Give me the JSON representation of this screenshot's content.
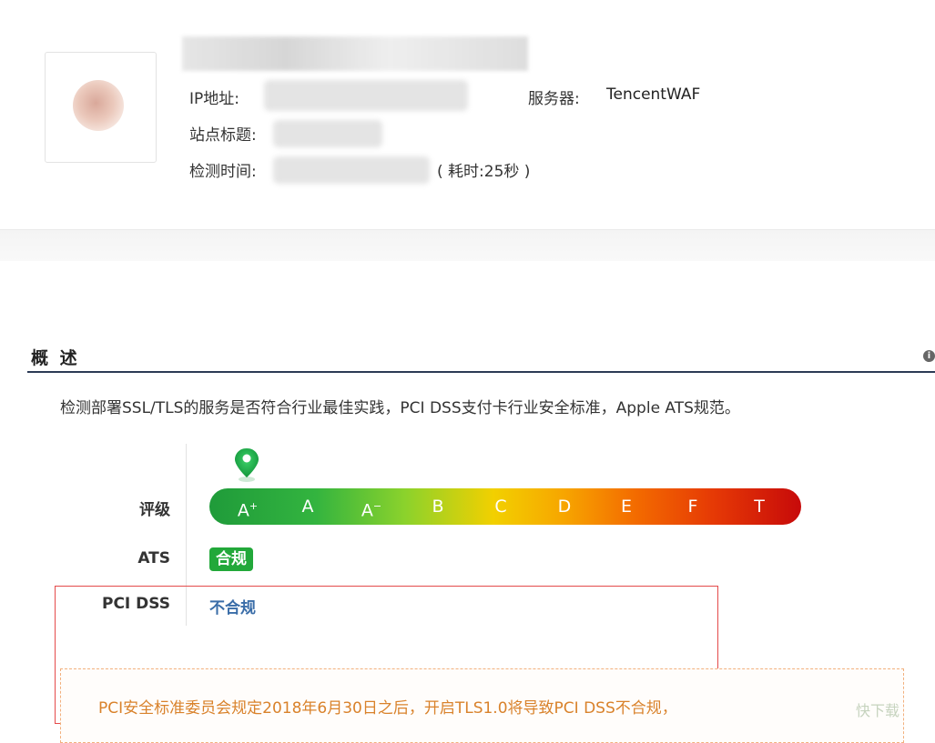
{
  "site": {
    "ip_label": "IP地址:",
    "server_label": "服务器:",
    "server_value": "TencentWAF",
    "title_label": "站点标题:",
    "time_label": "检测时间:",
    "duration_text": "( 耗时:25秒 )"
  },
  "overview": {
    "title": "概 述",
    "info_icon": "info-icon",
    "description": "检测部署SSL/TLS的服务是否符合行业最佳实践，PCI DSS支付卡行业安全标准，Apple ATS规范。"
  },
  "rating": {
    "label": "评级",
    "grades": [
      "A",
      "A",
      "A",
      "B",
      "C",
      "D",
      "E",
      "F",
      "T"
    ],
    "grade_a_plus_suffix": "+",
    "grade_a_minus_suffix": "−",
    "current_index": 0,
    "pin_icon": "map-pin-icon",
    "colors": {
      "start": "#1f9b3a",
      "mid": "#f2d000",
      "end": "#c70a0a"
    }
  },
  "ats": {
    "label": "ATS",
    "status": "合规",
    "status_color": "#22a83a"
  },
  "pci": {
    "label": "PCI DSS",
    "status": "不合规",
    "status_color": "#3a6da8"
  },
  "notice": {
    "text": "PCI安全标准委员会规定2018年6月30日之后，开启TLS1.0将导致PCI DSS不合规，"
  },
  "watermark": {
    "text": "快下载"
  }
}
